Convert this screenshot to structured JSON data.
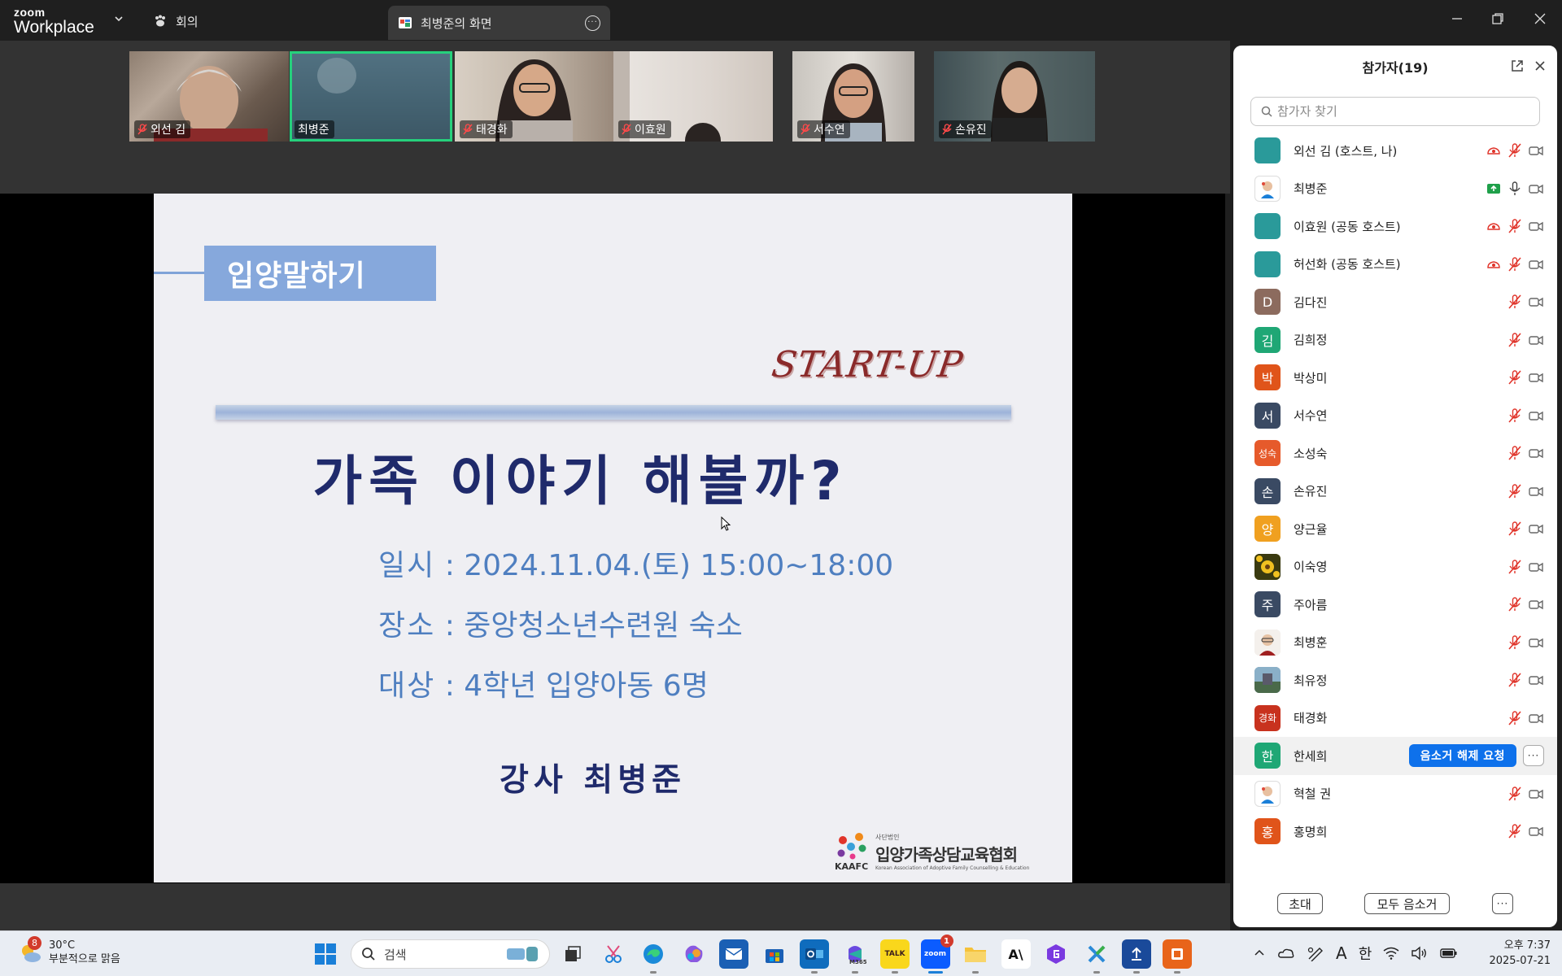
{
  "titlebar": {
    "brand_top": "zoom",
    "brand_bottom": "Workplace",
    "meeting_tab": "회의",
    "share_tab": "최병준의 화면"
  },
  "thumbnails": [
    {
      "name": "외선 김",
      "muted": true
    },
    {
      "name": "최병준",
      "muted": false,
      "active": true
    },
    {
      "name": "태경화",
      "muted": true
    },
    {
      "name": "이효원",
      "muted": true
    },
    {
      "name": "서수연",
      "muted": true
    },
    {
      "name": "손유진",
      "muted": true
    }
  ],
  "slide": {
    "tag": "입양말하기",
    "startup": "START-UP",
    "headline": "가족 이야기 해볼까?",
    "date_key": "일시",
    "date_val": ": 2024.11.04.(토) 15:00~18:00",
    "place_key": "장소",
    "place_val": ": 중앙청소년수련원 숙소",
    "target_key": "대상",
    "target_val": ": 4학년 입양아동 6명",
    "lecturer": "강사 최병준",
    "org_small": "사단법인",
    "org_name": "입양가족상담교육협회",
    "org_abbr": "KAAFC",
    "org_en": "Korean Association of Adoptive Family Counselling & Education"
  },
  "panel": {
    "title": "참가자(19)",
    "search_placeholder": "참가자 찾기",
    "participants": [
      {
        "name": "외선 김 (호스트, 나)",
        "avatar": "",
        "color": "#2a9a9a",
        "host_icon": true
      },
      {
        "name": "최병준",
        "avatar": "",
        "color": "#ffffff",
        "sharing": true
      },
      {
        "name": "이효원 (공동 호스트)",
        "avatar": "",
        "color": "#2a9a9a",
        "host_icon": true
      },
      {
        "name": "허선화 (공동 호스트)",
        "avatar": "",
        "color": "#2a9a9a",
        "host_icon": true
      },
      {
        "name": "김다진",
        "avatar": "D",
        "color": "#8c6b5e"
      },
      {
        "name": "김희정",
        "avatar": "김",
        "color": "#1fa775"
      },
      {
        "name": "박상미",
        "avatar": "박",
        "color": "#e0541a"
      },
      {
        "name": "서수연",
        "avatar": "서",
        "color": "#3a4a63"
      },
      {
        "name": "소성숙",
        "avatar": "성숙",
        "color": "#e65a2b"
      },
      {
        "name": "손유진",
        "avatar": "손",
        "color": "#3a4a63"
      },
      {
        "name": "양근율",
        "avatar": "양",
        "color": "#f0a020"
      },
      {
        "name": "이숙영",
        "avatar": "",
        "color": "#c9a11a"
      },
      {
        "name": "주아름",
        "avatar": "주",
        "color": "#3a4a63"
      },
      {
        "name": "최병훈",
        "avatar": "",
        "color": "#e8e0d8"
      },
      {
        "name": "최유정",
        "avatar": "",
        "color": "#6b8aa0"
      },
      {
        "name": "태경화",
        "avatar": "경화",
        "color": "#c8321e"
      },
      {
        "name": "한세희",
        "avatar": "한",
        "color": "#1fa775",
        "request": true
      },
      {
        "name": "혁철 권",
        "avatar": "",
        "color": "#ffffff"
      },
      {
        "name": "홍명희",
        "avatar": "홍",
        "color": "#e0541a"
      }
    ],
    "unmute_request": "음소거 해제 요청",
    "invite": "초대",
    "mute_all": "모두 음소거"
  },
  "taskbar": {
    "weather_badge": "8",
    "temp": "30°C",
    "weather": "부분적으로 맑음",
    "search": "검색",
    "zoom_badge": "1",
    "ime": "한",
    "time": "오후 7:37",
    "date": "2025-07-21"
  }
}
